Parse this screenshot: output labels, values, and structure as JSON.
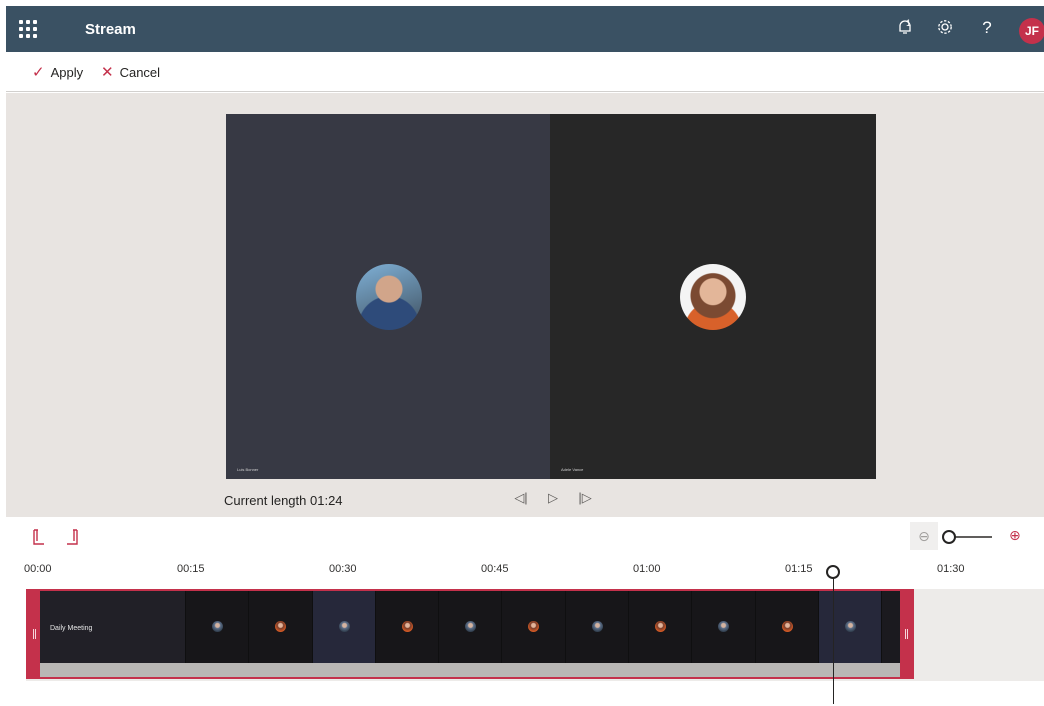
{
  "header": {
    "app_title": "Stream",
    "notification_count": "1",
    "avatar_initials": "JF",
    "help_label": "?"
  },
  "commands": {
    "apply_label": "Apply",
    "cancel_label": "Cancel"
  },
  "icons": {
    "waffle": "app-launcher-icon",
    "bell": "notification-bell-icon",
    "gear": "settings-gear-icon",
    "check": "checkmark-icon",
    "cross": "close-icon",
    "rewind": "previous-frame-icon",
    "play": "play-icon",
    "forward": "next-frame-icon",
    "trim_start": "trim-start-icon",
    "trim_end": "trim-end-icon",
    "zoom_out": "zoom-out-icon",
    "zoom_in": "zoom-in-icon"
  },
  "preview": {
    "participants": [
      {
        "name": "Luis Bonner"
      },
      {
        "name": "Adele Vance"
      }
    ],
    "current_length": "Current length 01:24"
  },
  "timeline": {
    "ticks": [
      "00:00",
      "00:15",
      "00:30",
      "00:45",
      "01:00",
      "01:15",
      "01:30"
    ],
    "first_frame_title": "Daily Meeting",
    "zoom_level": 0,
    "playhead_time_seconds": 79
  },
  "colors": {
    "header_bg": "#3a5163",
    "accent": "#c4314b",
    "stage_bg": "#e8e4e1"
  }
}
